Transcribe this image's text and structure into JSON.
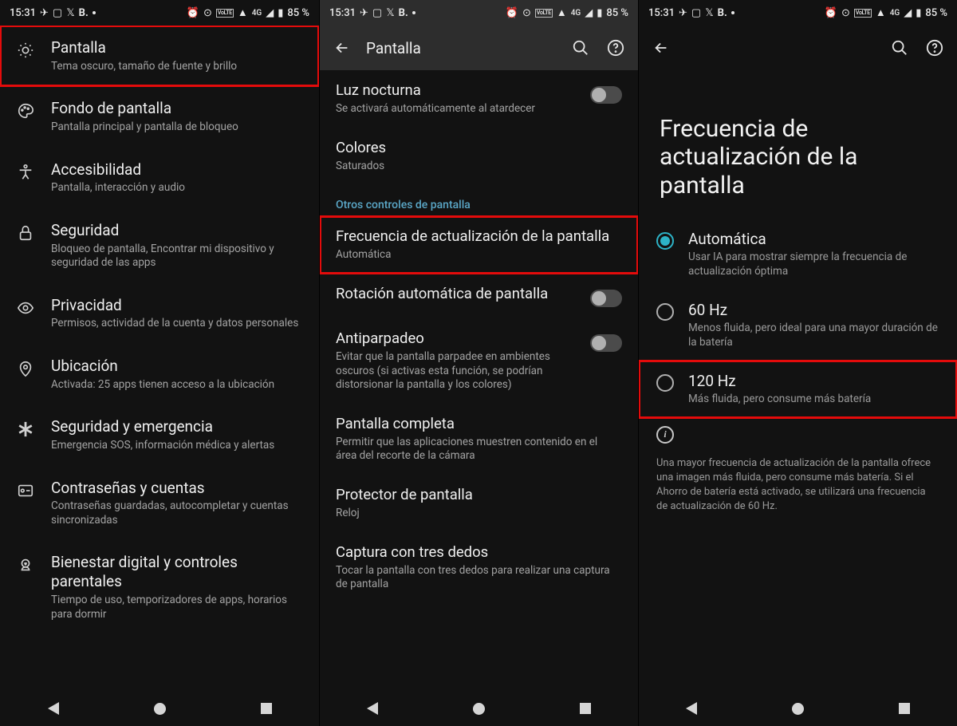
{
  "status": {
    "time": "15:31",
    "battery": "85 %",
    "net": "4G"
  },
  "panel1": {
    "items": [
      {
        "icon": "brightness",
        "title": "Pantalla",
        "sub": "Tema oscuro, tamaño de fuente y brillo",
        "hl": true
      },
      {
        "icon": "palette",
        "title": "Fondo de pantalla",
        "sub": "Pantalla principal y pantalla de bloqueo"
      },
      {
        "icon": "accessibility",
        "title": "Accesibilidad",
        "sub": "Pantalla, interacción y audio"
      },
      {
        "icon": "lock",
        "title": "Seguridad",
        "sub": "Bloqueo de pantalla, Encontrar mi dispositivo y seguridad de las apps"
      },
      {
        "icon": "eye",
        "title": "Privacidad",
        "sub": "Permisos, actividad de la cuenta y datos personales"
      },
      {
        "icon": "pin",
        "title": "Ubicación",
        "sub": "Activada: 25 apps tienen acceso a la ubicación"
      },
      {
        "icon": "star-life",
        "title": "Seguridad y emergencia",
        "sub": "Emergencia SOS, información médica y alertas"
      },
      {
        "icon": "key",
        "title": "Contraseñas y cuentas",
        "sub": "Contraseñas guardadas, autocompletar y cuentas sincronizadas"
      },
      {
        "icon": "wellbeing",
        "title": "Bienestar digital y controles parentales",
        "sub": "Tiempo de uso, temporizadores de apps, horarios para dormir"
      }
    ]
  },
  "panel2": {
    "title": "Pantalla",
    "rows": [
      {
        "title": "Luz nocturna",
        "sub": "Se activará automáticamente al atardecer",
        "toggle": "off"
      },
      {
        "title": "Colores",
        "sub": "Saturados"
      }
    ],
    "section": "Otros controles de pantalla",
    "rows2": [
      {
        "title": "Frecuencia de actualización de la pantalla",
        "sub": "Automática",
        "hl": true
      },
      {
        "title": "Rotación automática de pantalla",
        "toggle": "off"
      },
      {
        "title": "Antiparpadeo",
        "sub": "Evitar que la pantalla parpadee en ambientes oscuros (si activas esta función, se podrían distorsionar la pantalla y los colores)",
        "toggle": "off"
      },
      {
        "title": "Pantalla completa",
        "sub": "Permitir que las aplicaciones muestren contenido en el área del recorte de la cámara"
      },
      {
        "title": "Protector de pantalla",
        "sub": "Reloj"
      },
      {
        "title": "Captura con tres dedos",
        "sub": "Tocar la pantalla con tres dedos para realizar una captura de pantalla"
      }
    ]
  },
  "panel3": {
    "title": "Frecuencia de actualización de la pantalla",
    "options": [
      {
        "title": "Automática",
        "sub": "Usar IA para mostrar siempre la frecuencia de actualización óptima",
        "selected": true
      },
      {
        "title": "60 Hz",
        "sub": "Menos fluida, pero ideal para una mayor duración de la batería"
      },
      {
        "title": "120 Hz",
        "sub": "Más fluida, pero consume más batería",
        "hl": true
      }
    ],
    "footnote": "Una mayor frecuencia de actualización de la pantalla ofrece una imagen más fluida, pero consume más batería. Si el Ahorro de batería está activado, se utilizará una frecuencia de actualización de 60 Hz."
  }
}
